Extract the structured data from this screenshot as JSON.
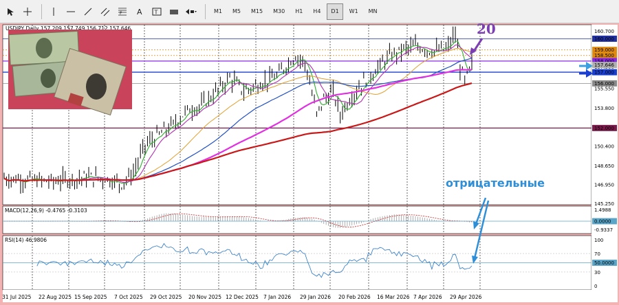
{
  "toolbar": {
    "timeframes": [
      "M1",
      "M5",
      "M15",
      "M30",
      "H1",
      "H4",
      "D1",
      "W1",
      "MN"
    ],
    "active_timeframe": "D1"
  },
  "chart": {
    "header": "USDJPY,Daily  157.209 157.749 156.712 157.646",
    "price_axis": [
      "160.700",
      "159.000",
      "157.500",
      "155.550",
      "153.800",
      "152.000",
      "150.400",
      "148.650",
      "146.950",
      "145.250"
    ],
    "level_tags": [
      {
        "label": "160.000",
        "color": "#2030a0"
      },
      {
        "label": "159.000",
        "color": "#e08a10"
      },
      {
        "label": "158.500",
        "color": "#e08a10"
      },
      {
        "label": "158.000",
        "color": "#8a2be2"
      },
      {
        "label": "157.646",
        "color": "#b0b0b0"
      },
      {
        "label": "157.000",
        "color": "#1a3fd0"
      },
      {
        "label": "156.000",
        "color": "#8a8a8a"
      },
      {
        "label": "152.000",
        "color": "#7a1a4a"
      }
    ],
    "dates": [
      "31 Jul 2025",
      "22 Aug 2025",
      "15 Sep 2025",
      "7 Oct 2025",
      "29 Oct 2025",
      "20 Nov 2025",
      "12 Dec 2025",
      "7 Jan 2026",
      "29 Jan 2026",
      "20 Feb 2026",
      "16 Mar 2026",
      "7 Apr 2026",
      "29 Apr 2026"
    ]
  },
  "macd": {
    "label": "MACD(12,26,9) -0.4765 -0.3103",
    "axis": [
      "1.4988",
      "0.0000",
      "-0.9337"
    ]
  },
  "rsi": {
    "label": "RSI(14) 46.9806",
    "axis": [
      "100",
      "70",
      "50.0000",
      "30",
      "0"
    ]
  },
  "annotations": {
    "number": "20",
    "word": "отрицательные"
  },
  "colors": {
    "background": "#f3b3b3",
    "ma_green": "#2fae2f",
    "ma_purple": "#b030b0",
    "ma_orange": "#e0a030",
    "ma_blue": "#2050c0",
    "ma_magenta": "#e030e0",
    "ma_red": "#c81818",
    "macd_signal": "#d02020",
    "rsi_line": "#2a78c8"
  },
  "photo_icon": "money-photo-icon"
}
